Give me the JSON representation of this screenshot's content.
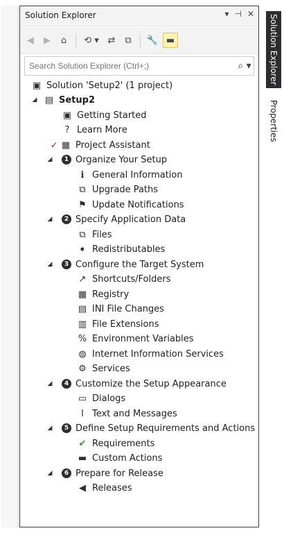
{
  "panel": {
    "title": "Solution Explorer",
    "title_controls": [
      "▾",
      "⊣",
      "✕"
    ]
  },
  "toolbar": {
    "back": "◀",
    "forward": "▶",
    "home": "⌂",
    "history": "⟲ ▾",
    "sync": "⇄",
    "collapse": "⧉",
    "properties": "🔧",
    "pin": "▬"
  },
  "search": {
    "placeholder": "Search Solution Explorer (Ctrl+;)",
    "icon": "⌕ ▾"
  },
  "tree": {
    "solution": "Solution 'Setup2' (1 project)",
    "project": "Setup2",
    "items": {
      "getting_started": "Getting Started",
      "learn_more": "Learn More",
      "project_assistant": "Project Assistant",
      "organize": "Organize Your Setup",
      "general_info": "General Information",
      "upgrade_paths": "Upgrade Paths",
      "update_notifications": "Update Notifications",
      "specify_app_data": "Specify Application Data",
      "files": "Files",
      "redistributables": "Redistributables",
      "configure_target": "Configure the Target System",
      "shortcuts": "Shortcuts/Folders",
      "registry": "Registry",
      "ini_changes": "INI File Changes",
      "file_extensions": "File Extensions",
      "env_vars": "Environment Variables",
      "iis": "Internet Information Services",
      "services": "Services",
      "customize_appearance": "Customize the Setup Appearance",
      "dialogs": "Dialogs",
      "text_messages": "Text and Messages",
      "define_requirements": "Define Setup Requirements and Actions",
      "requirements": "Requirements",
      "custom_actions": "Custom Actions",
      "prepare_release": "Prepare for Release",
      "releases": "Releases"
    },
    "step_numbers": [
      "1",
      "2",
      "3",
      "4",
      "5",
      "6"
    ]
  },
  "side_tabs": {
    "solution_explorer": "Solution Explorer",
    "properties": "Properties"
  },
  "colors": {
    "frame": "#3f3f46",
    "active_tab_bg": "#2d2d30",
    "checkmark": "#c00000",
    "requirements_check": "#2e9a2e"
  }
}
